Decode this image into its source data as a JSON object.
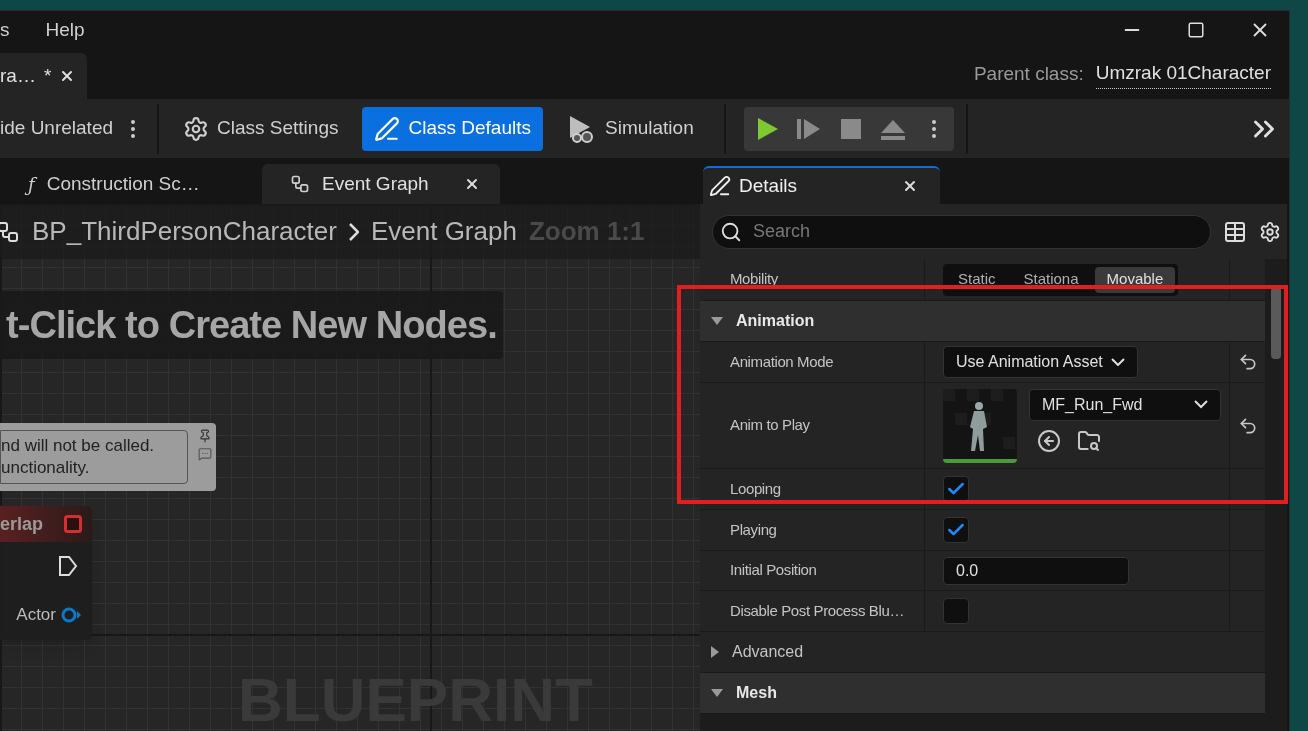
{
  "window": {
    "menu": [
      "s",
      "Help"
    ]
  },
  "document_tab": {
    "title": "ra…",
    "mark": "*"
  },
  "parent_class": {
    "label": "Parent class:",
    "value": "Umzrak 01Character"
  },
  "toolbar": {
    "filter": "ide Unrelated",
    "buttons": [
      {
        "kind": "settings",
        "label": "Class Settings",
        "selected": false
      },
      {
        "kind": "defaults",
        "label": "Class Defaults",
        "selected": true
      },
      {
        "kind": "simulation",
        "label": "Simulation",
        "selected": false
      }
    ]
  },
  "graph_tabs": [
    {
      "kind": "function",
      "glyph": "ƒ",
      "label": "Construction Sc…",
      "selected": false
    },
    {
      "kind": "graph",
      "label": "Event Graph",
      "selected": true
    }
  ],
  "breadcrumb": {
    "path": [
      "BP_ThirdPersonCharacter",
      "Event Graph"
    ],
    "zoom": "Zoom 1:1"
  },
  "graph": {
    "hint": "t-Click to Create New Nodes.",
    "comment": [
      "nd will not be called.",
      "unctionality."
    ],
    "event_node": {
      "title": "erlap",
      "pin": "Actor"
    },
    "watermark": "BLUEPRINT"
  },
  "details": {
    "title": "Details",
    "search": {
      "placeholder": "Search"
    },
    "rows": [
      {
        "kind": "segmented",
        "label": "Mobility",
        "options": [
          {
            "label": "Static",
            "selected": false
          },
          {
            "label": "Stationa",
            "selected": false
          },
          {
            "label": "Movable",
            "selected": true
          }
        ]
      },
      {
        "kind": "category",
        "label": "Animation",
        "expanded": true,
        "children": [
          {
            "kind": "dropdown",
            "label": "Animation Mode",
            "value": "Use Animation Asset",
            "resettable": true
          },
          {
            "kind": "asset",
            "label": "Anim to Play",
            "value": "MF_Run_Fwd",
            "resettable": true
          },
          {
            "kind": "checkbox",
            "label": "Looping",
            "checked": true
          },
          {
            "kind": "checkbox",
            "label": "Playing",
            "checked": true
          },
          {
            "kind": "number",
            "label": "Initial Position",
            "value": "0.0"
          },
          {
            "kind": "checkbox",
            "label": "Disable Post Process Blu…",
            "checked": false
          },
          {
            "kind": "group",
            "label": "Advanced",
            "expanded": false
          }
        ]
      },
      {
        "kind": "category",
        "label": "Mesh",
        "expanded": true
      }
    ]
  }
}
